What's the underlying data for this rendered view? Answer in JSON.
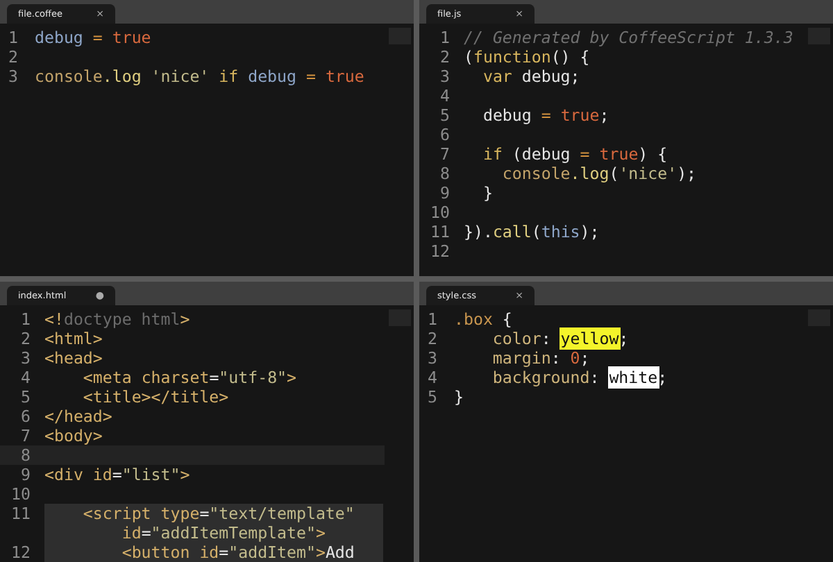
{
  "panes": [
    {
      "tab": {
        "title": "file.coffee",
        "close": "×"
      },
      "lines": [
        {
          "number": "1",
          "tokens": [
            {
              "kind": "var",
              "text": "debug"
            },
            {
              "kind": "op",
              "text": " = "
            },
            {
              "kind": "bool",
              "text": "true"
            }
          ]
        },
        {
          "number": "2"
        },
        {
          "number": "3",
          "tokens": [
            {
              "kind": "builtin",
              "text": "console"
            },
            {
              "kind": "fn",
              "text": ".log"
            },
            {
              "kind": "str",
              "text": " 'nice' "
            },
            {
              "kind": "kw",
              "text": "if "
            },
            {
              "kind": "var",
              "text": "debug"
            },
            {
              "kind": "op",
              "text": " = "
            },
            {
              "kind": "bool",
              "text": "true"
            }
          ]
        }
      ]
    },
    {
      "tab": {
        "title": "file.js",
        "close": "×"
      },
      "lines": [
        {
          "number": "1",
          "tokens": [
            {
              "kind": "comment",
              "text": "// Generated by CoffeeScript 1.3.3"
            }
          ]
        },
        {
          "number": "2",
          "tokens": [
            {
              "kind": "plain",
              "text": "("
            },
            {
              "kind": "kw",
              "text": "function"
            },
            {
              "kind": "plain",
              "text": "() {"
            }
          ]
        },
        {
          "number": "3",
          "tokens": [
            {
              "kind": "kw",
              "text": "  var"
            },
            {
              "kind": "plain",
              "text": " debug;"
            }
          ]
        },
        {
          "number": "4"
        },
        {
          "number": "5",
          "tokens": [
            {
              "kind": "plain",
              "text": "  debug"
            },
            {
              "kind": "op",
              "text": " = "
            },
            {
              "kind": "bool",
              "text": "true"
            },
            {
              "kind": "plain",
              "text": ";"
            }
          ]
        },
        {
          "number": "6"
        },
        {
          "number": "7",
          "tokens": [
            {
              "kind": "kw",
              "text": "  if"
            },
            {
              "kind": "plain",
              "text": " (debug"
            },
            {
              "kind": "op",
              "text": " = "
            },
            {
              "kind": "bool",
              "text": "true"
            },
            {
              "kind": "plain",
              "text": ") {"
            }
          ]
        },
        {
          "number": "8",
          "tokens": [
            {
              "kind": "builtin",
              "text": "    console"
            },
            {
              "kind": "fn",
              "text": ".log"
            },
            {
              "kind": "plain",
              "text": "("
            },
            {
              "kind": "str",
              "text": "'nice'"
            },
            {
              "kind": "plain",
              "text": ");"
            }
          ]
        },
        {
          "number": "9",
          "tokens": [
            {
              "kind": "plain",
              "text": "  }"
            }
          ]
        },
        {
          "number": "10"
        },
        {
          "number": "11",
          "tokens": [
            {
              "kind": "plain",
              "text": "})."
            },
            {
              "kind": "fn",
              "text": "call"
            },
            {
              "kind": "plain",
              "text": "("
            },
            {
              "kind": "var",
              "text": "this"
            },
            {
              "kind": "plain",
              "text": ");"
            }
          ]
        },
        {
          "number": "12"
        }
      ]
    },
    {
      "tab": {
        "title": "index.html",
        "close": "●"
      },
      "lines": [
        {
          "number": "1",
          "current": false,
          "highlighted": false,
          "tokens": [
            {
              "kind": "tag",
              "text": "<!"
            },
            {
              "kind": "comment2",
              "text": "doctype html"
            },
            {
              "kind": "tag",
              "text": ">"
            }
          ]
        },
        {
          "number": "2",
          "current": false,
          "highlighted": false,
          "tokens": [
            {
              "kind": "tag",
              "text": "<html>"
            }
          ]
        },
        {
          "number": "3",
          "current": false,
          "highlighted": false,
          "tokens": [
            {
              "kind": "tag",
              "text": "<head>"
            }
          ]
        },
        {
          "number": "4",
          "current": false,
          "highlighted": false,
          "tokens": [
            {
              "kind": "tag",
              "text": "    <meta "
            },
            {
              "kind": "attr",
              "text": "charset"
            },
            {
              "kind": "plain",
              "text": "="
            },
            {
              "kind": "str",
              "text": "\"utf-8\""
            },
            {
              "kind": "tag",
              "text": ">"
            }
          ]
        },
        {
          "number": "5",
          "current": false,
          "highlighted": false,
          "tokens": [
            {
              "kind": "tag",
              "text": "    <title></title>"
            }
          ]
        },
        {
          "number": "6",
          "current": false,
          "highlighted": false,
          "tokens": [
            {
              "kind": "tag",
              "text": "</head>"
            }
          ]
        },
        {
          "number": "7",
          "current": false,
          "highlighted": false,
          "tokens": [
            {
              "kind": "tag",
              "text": "<body>"
            }
          ]
        },
        {
          "number": "8",
          "current": true,
          "highlighted": false
        },
        {
          "number": "9",
          "current": false,
          "highlighted": false,
          "tokens": [
            {
              "kind": "tag",
              "text": "<div "
            },
            {
              "kind": "attr",
              "text": "id"
            },
            {
              "kind": "plain",
              "text": "="
            },
            {
              "kind": "str",
              "text": "\"list\""
            },
            {
              "kind": "tag",
              "text": ">"
            }
          ]
        },
        {
          "number": "10",
          "current": false,
          "highlighted": false
        },
        {
          "number": "11",
          "current": false,
          "highlighted": true,
          "tokens": [
            {
              "kind": "tag",
              "text": "    <script "
            },
            {
              "kind": "attr",
              "text": "type"
            },
            {
              "kind": "plain",
              "text": "="
            },
            {
              "kind": "str",
              "text": "\"text/template\""
            }
          ],
          "continuation": [
            {
              "kind": "attr",
              "text": "        id"
            },
            {
              "kind": "plain",
              "text": "="
            },
            {
              "kind": "str",
              "text": "\"addItemTemplate\""
            },
            {
              "kind": "tag",
              "text": ">"
            }
          ]
        },
        {
          "number": "12",
          "current": false,
          "highlighted": true,
          "tokens": [
            {
              "kind": "tag",
              "text": "        <button "
            },
            {
              "kind": "attr",
              "text": "id"
            },
            {
              "kind": "plain",
              "text": "="
            },
            {
              "kind": "str",
              "text": "\"addItem\""
            },
            {
              "kind": "tag",
              "text": ">"
            },
            {
              "kind": "plain",
              "text": "Add"
            }
          ]
        }
      ]
    },
    {
      "tab": {
        "title": "style.css",
        "close": "×"
      },
      "lines": [
        {
          "number": "1",
          "tokens": [
            {
              "kind": "selector",
              "text": ".box"
            },
            {
              "kind": "plain",
              "text": " {"
            }
          ]
        },
        {
          "number": "2",
          "tokens": [
            {
              "kind": "prop",
              "text": "    color"
            },
            {
              "kind": "plain",
              "text": ": "
            },
            {
              "kind": "swatch",
              "text": "yellow",
              "color": "#f4f42a"
            },
            {
              "kind": "plain",
              "text": ";"
            }
          ]
        },
        {
          "number": "3",
          "tokens": [
            {
              "kind": "prop",
              "text": "    margin"
            },
            {
              "kind": "plain",
              "text": ": "
            },
            {
              "kind": "bool",
              "text": "0"
            },
            {
              "kind": "plain",
              "text": ";"
            }
          ]
        },
        {
          "number": "4",
          "tokens": [
            {
              "kind": "prop",
              "text": "    background"
            },
            {
              "kind": "plain",
              "text": ": "
            },
            {
              "kind": "swatch",
              "text": "white",
              "color": "#ffffff"
            },
            {
              "kind": "plain",
              "text": ";"
            }
          ]
        },
        {
          "number": "5",
          "tokens": [
            {
              "kind": "plain",
              "text": "}"
            }
          ]
        }
      ]
    }
  ]
}
